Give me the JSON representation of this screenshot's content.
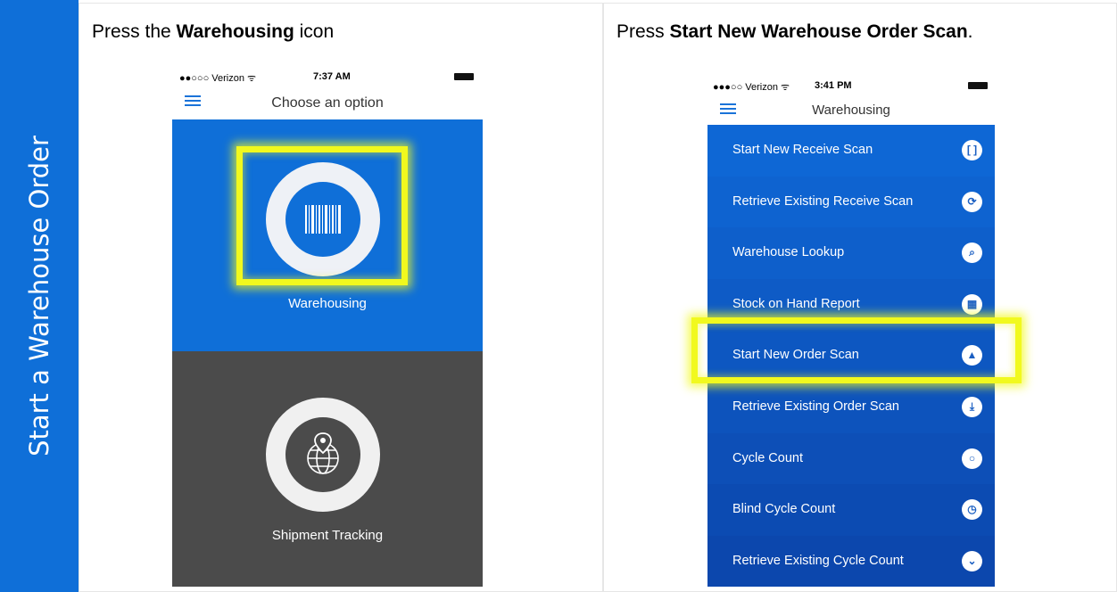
{
  "sidebar": {
    "label": "Start a Warehouse Order"
  },
  "left": {
    "instruction_prefix": "Press the ",
    "instruction_bold": "Warehousing",
    "instruction_suffix": " icon",
    "phone": {
      "carrier": "●●○○○ Verizon ᯤ",
      "time": "7:37 AM",
      "title": "Choose an option",
      "tiles": [
        {
          "label": "Warehousing",
          "icon": "barcode-icon"
        },
        {
          "label": "Shipment Tracking",
          "icon": "globe-pin-icon"
        }
      ]
    }
  },
  "right": {
    "instruction_prefix": "Press ",
    "instruction_bold": "Start New Warehouse Order Scan",
    "instruction_suffix": ".",
    "phone": {
      "carrier": "●●●○○ Verizon ᯤ",
      "time": "3:41 PM",
      "title": "Warehousing",
      "menu": [
        {
          "label": "Start New Receive Scan",
          "icon": "bracket-scan-icon",
          "glyph": "[ ]",
          "color": "#0e67d5"
        },
        {
          "label": "Retrieve Existing Receive Scan",
          "icon": "refresh-icon",
          "glyph": "⟳",
          "color": "#0e63d0"
        },
        {
          "label": "Warehouse Lookup",
          "icon": "search-icon",
          "glyph": "⌕",
          "color": "#0e5fcb"
        },
        {
          "label": "Stock on Hand Report",
          "icon": "grid-icon",
          "glyph": "▦",
          "color": "#0e5bc6"
        },
        {
          "label": "Start New Order Scan",
          "icon": "upload-icon",
          "glyph": "▲",
          "color": "#0d57c1"
        },
        {
          "label": "Retrieve Existing Order Scan",
          "icon": "download-icon",
          "glyph": "⤓",
          "color": "#0d53bc"
        },
        {
          "label": "Cycle Count",
          "icon": "circle-icon",
          "glyph": "○",
          "color": "#0d4fb7"
        },
        {
          "label": "Blind Cycle Count",
          "icon": "clock-icon",
          "glyph": "◷",
          "color": "#0c4bb2"
        },
        {
          "label": "Retrieve Existing Cycle Count",
          "icon": "chevron-circle-icon",
          "glyph": "⌄",
          "color": "#0c47ad"
        }
      ]
    }
  }
}
